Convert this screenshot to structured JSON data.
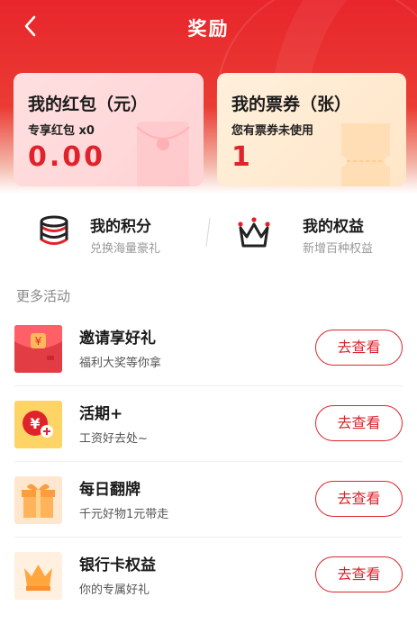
{
  "header": {
    "title": "奖励"
  },
  "cards": {
    "red_packet": {
      "title": "我的红包（元）",
      "subtitle": "专享红包 x0",
      "value": "0.00"
    },
    "vouchers": {
      "title": "我的票券（张）",
      "subtitle": "您有票券未使用",
      "value": "1"
    }
  },
  "quick": [
    {
      "title": "我的积分",
      "desc": "兑换海量豪礼",
      "icon": "coins-stack-icon"
    },
    {
      "title": "我的权益",
      "desc": "新增百种权益",
      "icon": "crown-icon"
    }
  ],
  "section": {
    "label": "更多活动"
  },
  "activities": [
    {
      "title": "邀请享好礼",
      "desc": "福利大奖等你拿",
      "button": "去查看",
      "icon": "red-envelope-icon"
    },
    {
      "title": "活期+",
      "desc": "工资好去处~",
      "button": "去查看",
      "icon": "yuan-coin-plus-icon"
    },
    {
      "title": "每日翻牌",
      "desc": "千元好物1元带走",
      "button": "去查看",
      "icon": "gift-box-icon"
    },
    {
      "title": "银行卡权益",
      "desc": "你的专属好礼",
      "button": "去查看",
      "icon": "crown-icon"
    }
  ],
  "colors": {
    "brand_red": "#e0232b",
    "header_red": "#e8262c"
  }
}
